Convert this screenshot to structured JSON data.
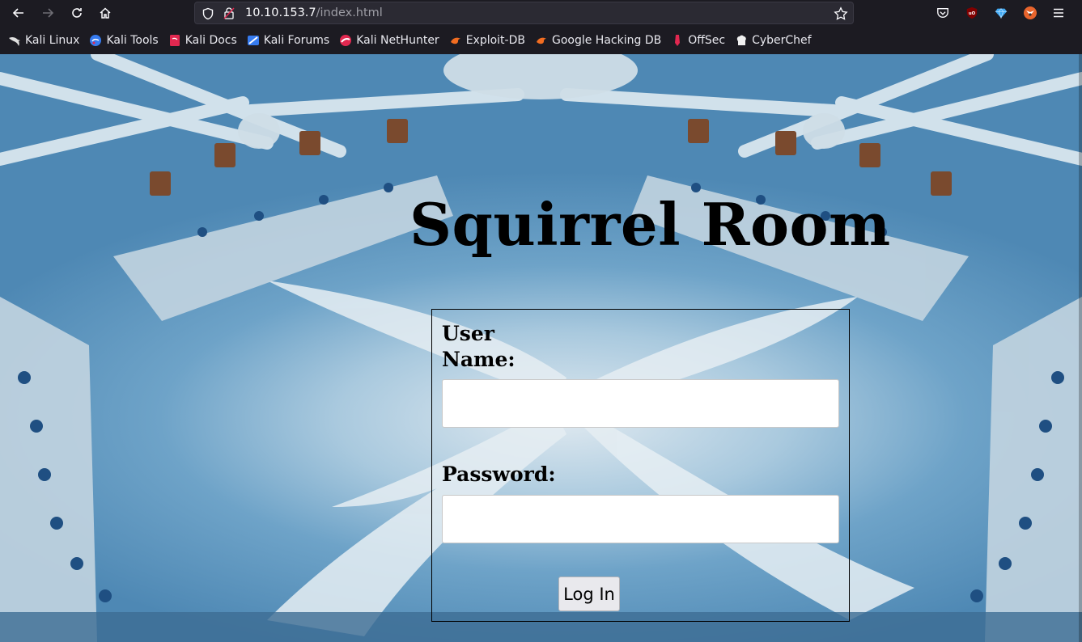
{
  "browser": {
    "url_host": "10.10.153.7",
    "url_path": "/index.html"
  },
  "bookmarks": [
    {
      "label": "Kali Linux",
      "icon": "kali-dragon-icon"
    },
    {
      "label": "Kali Tools",
      "icon": "kali-tools-icon"
    },
    {
      "label": "Kali Docs",
      "icon": "kali-docs-icon"
    },
    {
      "label": "Kali Forums",
      "icon": "kali-forums-icon"
    },
    {
      "label": "Kali NetHunter",
      "icon": "nethunter-icon"
    },
    {
      "label": "Exploit-DB",
      "icon": "exploit-db-icon"
    },
    {
      "label": "Google Hacking DB",
      "icon": "ghdb-icon"
    },
    {
      "label": "OffSec",
      "icon": "offsec-icon"
    },
    {
      "label": "CyberChef",
      "icon": "cyberchef-icon"
    }
  ],
  "page": {
    "title": "Squirrel Room",
    "username_label": "User Name:",
    "username_value": "",
    "password_label": "Password:",
    "password_value": "",
    "login_button": "Log In"
  },
  "colors": {
    "chrome_bg": "#1c1b22",
    "urlbar_bg": "#2b2a33",
    "accent_red": "#e22850"
  }
}
